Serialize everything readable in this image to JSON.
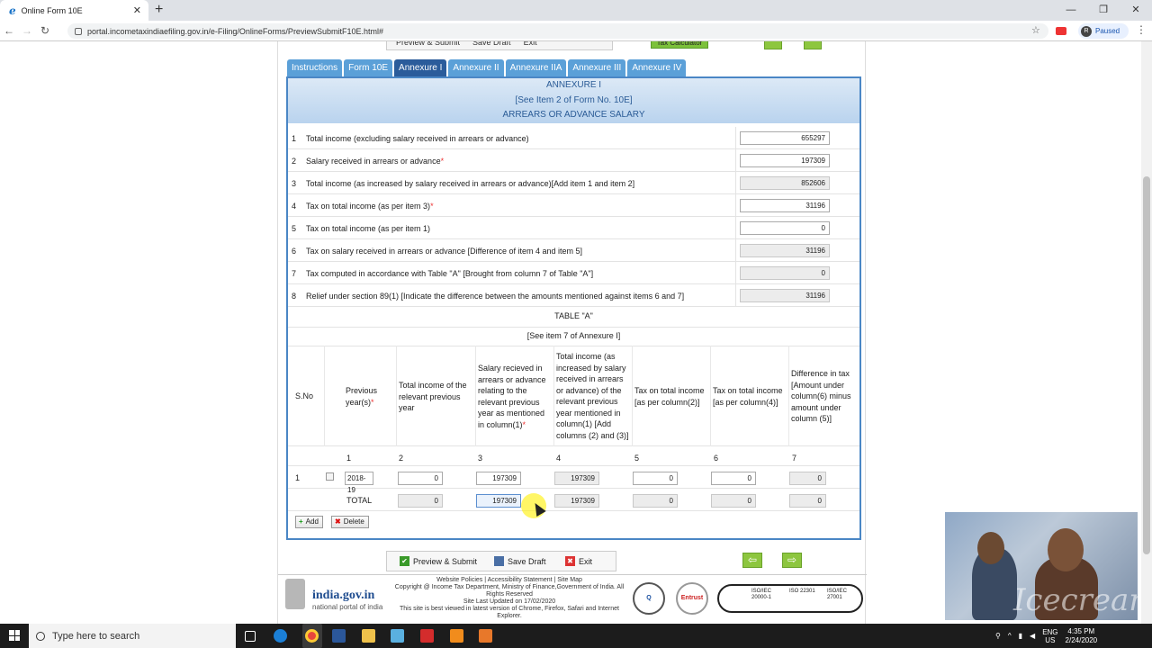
{
  "browser": {
    "tab_title": "Online Form 10E",
    "tab_icon": "e",
    "url": "portal.incometaxindiaefiling.gov.in/e-Filing/OnlineForms/PreviewSubmitF10E.html#",
    "profile_initial": "R",
    "profile_status": "Paused",
    "new_tab": "+",
    "close_tab": "✕",
    "win_min": "—",
    "win_max": "❐",
    "win_close": "✕"
  },
  "toolbar_top": {
    "preview": "Preview & Submit",
    "save": "Save Draft",
    "exit": "Exit",
    "tax_calc": "Tax Calculator"
  },
  "tabs": [
    {
      "label": "Instructions",
      "active": false
    },
    {
      "label": "Form 10E",
      "active": false
    },
    {
      "label": "Annexure I",
      "active": true
    },
    {
      "label": "Annexure II",
      "active": false
    },
    {
      "label": "Annexure IIA",
      "active": false
    },
    {
      "label": "Annexure III",
      "active": false
    },
    {
      "label": "Annexure IV",
      "active": false
    }
  ],
  "panel": {
    "heading1": "ANNEXURE I",
    "heading2": "[See Item 2 of Form No. 10E]",
    "heading3": "ARREARS OR ADVANCE SALARY"
  },
  "items": [
    {
      "num": "1",
      "label": "Total income (excluding salary received in arrears or advance)",
      "required": false,
      "value": "655297",
      "readonly": false
    },
    {
      "num": "2",
      "label": "Salary received in arrears or advance",
      "required": true,
      "value": "197309",
      "readonly": false
    },
    {
      "num": "3",
      "label": "Total income (as increased by salary received in arrears or advance)[Add item 1 and item 2]",
      "required": false,
      "value": "852606",
      "readonly": true
    },
    {
      "num": "4",
      "label": "Tax on total income (as per item 3)",
      "required": true,
      "value": "31196",
      "readonly": false
    },
    {
      "num": "5",
      "label": "Tax on total income (as per item 1)",
      "required": false,
      "value": "0",
      "readonly": false
    },
    {
      "num": "6",
      "label": "Tax on salary received in arrears or advance [Difference of item 4 and item 5]",
      "required": false,
      "value": "31196",
      "readonly": true
    },
    {
      "num": "7",
      "label": "Tax computed in accordance with Table \"A\" [Brought from column 7 of Table \"A\"]",
      "required": false,
      "value": "0",
      "readonly": true
    },
    {
      "num": "8",
      "label": "Relief under section 89(1) [Indicate the difference between the amounts mentioned against items 6 and 7]",
      "required": false,
      "value": "31196",
      "readonly": true
    }
  ],
  "required_mark": "*",
  "table_a": {
    "title": "TABLE \"A\"",
    "subtitle": "[See item 7 of Annexure I]",
    "headers": {
      "sno": "S.No",
      "c1": "Previous year(s)",
      "c2": "Total income of the relevant previous year",
      "c3": "Salary recieved in arrears or advance relating to the relevant previous year as mentioned in column(1)",
      "c4": "Total income (as increased by salary received in arrears or advance) of the relevant previous year mentioned in column(1) [Add columns (2) and (3)]",
      "c5": "Tax on total income [as per column(2)]",
      "c6": "Tax on total income [as per column(4)]",
      "c7": "Difference in tax [Amount under column(6) minus amount under column (5)]"
    },
    "colnums": [
      "1",
      "2",
      "3",
      "4",
      "5",
      "6",
      "7"
    ],
    "row1": {
      "sno": "1",
      "year": "2018-19",
      "c2": "0",
      "c3": "197309",
      "c4": "197309",
      "c5": "0",
      "c6": "0",
      "c7": "0"
    },
    "total": {
      "label": "TOTAL",
      "c2": "0",
      "c3": "197309",
      "c4": "197309",
      "c5": "0",
      "c6": "0",
      "c7": "0"
    },
    "add_label": "Add",
    "delete_label": "Delete"
  },
  "toolbar_bottom": {
    "preview": "Preview & Submit",
    "save": "Save Draft",
    "exit": "Exit"
  },
  "footer": {
    "site": "india.gov.in",
    "site_sub": "national portal of india",
    "links": "Website Policies | Accessibility Statement | Site Map",
    "copyright": "Copyright @ Income Tax Department, Ministry of Finance,Government of India. All Rights Reserved",
    "updated": "Site Last Updated on 17/02/2020",
    "browsers": "This site is best viewed in latest version of Chrome, Firefox, Safari and Internet Explorer.",
    "entrust": "Entrust",
    "iso1": "ISO/IEC 20000-1",
    "iso2": "ISO 22301",
    "iso3": "ISO/IEC 27001"
  },
  "webcam_watermark": "Icecream",
  "taskbar": {
    "search_placeholder": "Type here to search",
    "lang1": "ENG",
    "lang2": "US",
    "time": "4:35 PM",
    "date": "2/24/2020"
  },
  "colors": {
    "tab_bg": "#5ba0d8",
    "tab_active": "#2b5c9b",
    "panel_border": "#4a86c5",
    "header_text": "#2a5b96",
    "green_button": "#8dc63f"
  }
}
